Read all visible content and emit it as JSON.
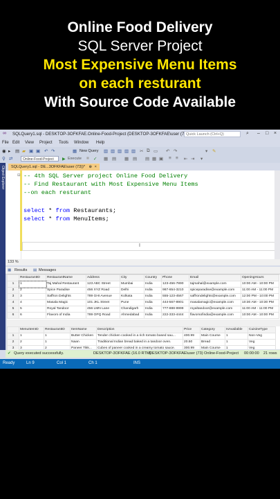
{
  "headline": {
    "line1": "Online Food Delivery",
    "line2": "SQL Server Project",
    "line3": "Most Expensive Menu Items",
    "line4": "on each resturant",
    "line5": "With Source Code Available"
  },
  "window": {
    "title": "SQLQuery1.sql - DESKTOP-3OFKFAE.Online-Food-Project (DESKTOP-3OFKFAE\\user (73))* - Micro...",
    "quick_launch_placeholder": "Quick Launch (Ctrl+Q)"
  },
  "menu": [
    "File",
    "Edit",
    "View",
    "Project",
    "Tools",
    "Window",
    "Help"
  ],
  "toolbar": {
    "new_query": "New Query",
    "database": "Online-Food-Project",
    "execute": "Execute"
  },
  "sidebar_label": "Object Explorer",
  "tab": {
    "label": "SQLQuery1.sql - DE...3OFKFAE\\user (73))*"
  },
  "editor": {
    "comment1": "-- 4th SQL Server project Online Food Delivery",
    "comment2": "-- Find Restaurant with Most Expensive Menu Items",
    "comment3": "--on each resturant",
    "select1_kw": "select",
    "select1_star": " * ",
    "select1_from": "from",
    "select1_table": " Restaurants;",
    "select2_kw": "select",
    "select2_star": " * ",
    "select2_from": "from",
    "select2_table": " MenuItems;"
  },
  "zoom": "133 %",
  "results_tabs": {
    "results": "Results",
    "messages": "Messages"
  },
  "restaurants": {
    "columns": [
      "RestaurantID",
      "RestaurantName",
      "Address",
      "City",
      "Country",
      "Phone",
      "Email",
      "OpeningHours"
    ],
    "rows": [
      [
        "1",
        "1",
        "Taj Mahal Restaurant",
        "123 ABC Street",
        "Mumbai",
        "India",
        "123-456-7890",
        "tajmahal@example.com",
        "10:00 AM - 10:00 PM"
      ],
      [
        "2",
        "2",
        "Spice Paradise",
        "456 XYZ Road",
        "Delhi",
        "India",
        "987-654-3210",
        "spiceparadise@example.com",
        "11:00 AM - 11:00 PM"
      ],
      [
        "3",
        "3",
        "Saffron Delights",
        "789 GHI Avenue",
        "Kolkata",
        "India",
        "555-123-4567",
        "saffrondelights@example.com",
        "12:00 PM - 10:00 PM"
      ],
      [
        "4",
        "4",
        "Masala Magic",
        "101 JKL Street",
        "Pune",
        "India",
        "444-567-8901",
        "masalamagic@example.com",
        "10:30 AM - 10:30 PM"
      ],
      [
        "5",
        "5",
        "Royal Tandoor",
        "456 LMN Lane",
        "Chandigarh",
        "India",
        "777-888-9999",
        "royaltandoor@example.com",
        "11:00 AM - 11:00 PM"
      ],
      [
        "6",
        "6",
        "Flavors of India",
        "789 OPQ Road",
        "Ahmedabad",
        "India",
        "222-333-4444",
        "flavorsofindia@example.com",
        "10:00 AM - 10:00 PM"
      ]
    ]
  },
  "menuitems": {
    "columns": [
      "MenuItemID",
      "RestaurantID",
      "ItemName",
      "Description",
      "Price",
      "Category",
      "IsAvailable",
      "CuisineType"
    ],
    "rows": [
      [
        "1",
        "1",
        "1",
        "Butter Chicken",
        "Tender chicken cooked in a rich tomato based sau...",
        "400.99",
        "Main Course",
        "1",
        "Non-Veg"
      ],
      [
        "2",
        "2",
        "1",
        "Naan",
        "Traditional Indian bread baked in a tandoor oven.",
        "20.50",
        "Bread",
        "1",
        "Veg"
      ],
      [
        "3",
        "3",
        "2",
        "Paneer Tikk...",
        "Cubes of paneer cooked in a creamy tomato sauce.",
        "300.99",
        "Main Course",
        "1",
        "Veg"
      ]
    ]
  },
  "query_status": {
    "message": "Query executed successfully.",
    "server": "DESKTOP-3OFKFAE (16.0 RTM)",
    "user": "DESKTOP-3OFKFAE\\user (73)",
    "database": "Online-Food-Project",
    "elapsed": "00:00:00",
    "rows": "21 rows"
  },
  "statusbar": {
    "ready": "Ready",
    "ln": "Ln 9",
    "col": "Col 1",
    "ch": "Ch 1",
    "ins": "INS"
  },
  "colors": {
    "title_yellow": "#ffe600",
    "status_blue": "#0a6ab8",
    "tab_orange": "#f5cc84"
  }
}
